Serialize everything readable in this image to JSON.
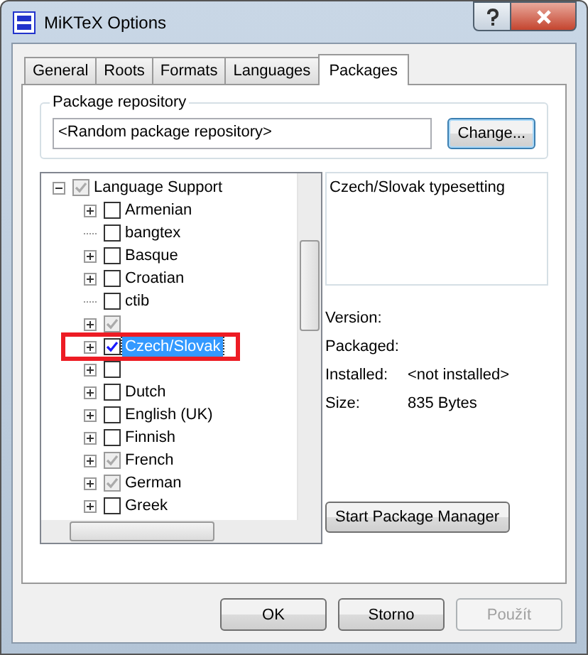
{
  "window": {
    "title": "MiKTeX Options"
  },
  "tabs": [
    {
      "label": "General",
      "selected": false
    },
    {
      "label": "Roots",
      "selected": false
    },
    {
      "label": "Formats",
      "selected": false
    },
    {
      "label": "Languages",
      "selected": false
    },
    {
      "label": "Packages",
      "selected": true
    }
  ],
  "repository": {
    "group_label": "Package repository",
    "value": "<Random package repository>",
    "button": "Change..."
  },
  "tree": [
    {
      "label": "Language Support",
      "checked": true,
      "greyed": true,
      "expanded": true,
      "selected": false,
      "children": [
        {
          "label": "Armenian",
          "checked": false,
          "greyed": false,
          "has_children": true,
          "selected": false,
          "highlighted": false
        },
        {
          "label": "bangtex",
          "checked": false,
          "greyed": false,
          "has_children": false,
          "selected": false,
          "highlighted": false
        },
        {
          "label": "Basque",
          "checked": false,
          "greyed": false,
          "has_children": true,
          "selected": false,
          "highlighted": false
        },
        {
          "label": "Croatian",
          "checked": false,
          "greyed": false,
          "has_children": true,
          "selected": false,
          "highlighted": false
        },
        {
          "label": "ctib",
          "checked": false,
          "greyed": false,
          "has_children": false,
          "selected": false,
          "highlighted": false
        },
        {
          "checked": true,
          "greyed": true,
          "has_children": true,
          "selected": false,
          "highlighted": false
        },
        {
          "label": "Czech/Slovak",
          "checked": true,
          "greyed": false,
          "has_children": true,
          "selected": true,
          "highlighted": true
        },
        {
          "checked": false,
          "greyed": false,
          "has_children": true,
          "selected": false,
          "highlighted": false
        },
        {
          "label": "Dutch",
          "checked": false,
          "greyed": false,
          "has_children": true,
          "selected": false,
          "highlighted": false
        },
        {
          "label": "English (UK)",
          "checked": false,
          "greyed": false,
          "has_children": true,
          "selected": false,
          "highlighted": false
        },
        {
          "label": "Finnish",
          "checked": false,
          "greyed": false,
          "has_children": true,
          "selected": false,
          "highlighted": false
        },
        {
          "label": "French",
          "checked": true,
          "greyed": true,
          "has_children": true,
          "selected": false,
          "highlighted": false
        },
        {
          "label": "German",
          "checked": true,
          "greyed": true,
          "has_children": true,
          "selected": false,
          "highlighted": false
        },
        {
          "label": "Greek",
          "checked": false,
          "greyed": false,
          "has_children": true,
          "selected": false,
          "highlighted": false
        }
      ]
    }
  ],
  "description": "Czech/Slovak typesetting",
  "info": [
    {
      "label": "Version:"
    },
    {
      "label": "Packaged:"
    },
    {
      "label": "Installed:",
      "value": "<not installed>"
    },
    {
      "label": "Size:",
      "value": "835 Bytes"
    }
  ],
  "package_manager_button": "Start Package Manager",
  "buttons": [
    {
      "label": "OK",
      "disabled": false
    },
    {
      "label": "Storno",
      "disabled": false
    },
    {
      "label": "Použít",
      "disabled": true
    }
  ]
}
